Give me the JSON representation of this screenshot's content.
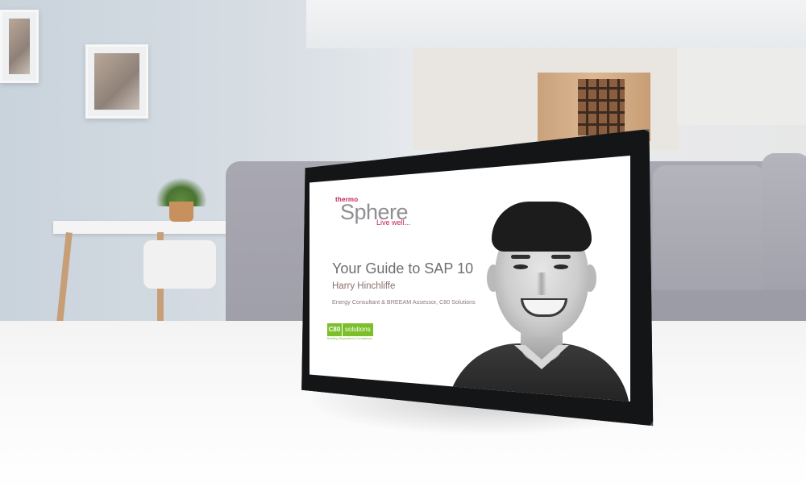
{
  "scene": {
    "description_type": "photo of tablet on table in living room"
  },
  "slide": {
    "brand_prefix": "thermo",
    "brand_name": "Sphere",
    "brand_tagline": "Live well",
    "brand_tagline_dots": "...",
    "title": "Your Guide to SAP 10",
    "presenter_name": "Harry Hinchliffe",
    "presenter_role": "Energy Consultant & BREEAM Assessor, C80 Solutions",
    "partner_logo": {
      "mark": "C80",
      "word": "solutions",
      "subtitle": "Building Regulations Compliance"
    }
  },
  "colors": {
    "brand_accent": "#c3215a",
    "brand_gray": "#8f8f93",
    "partner_green": "#7cbf2a"
  }
}
